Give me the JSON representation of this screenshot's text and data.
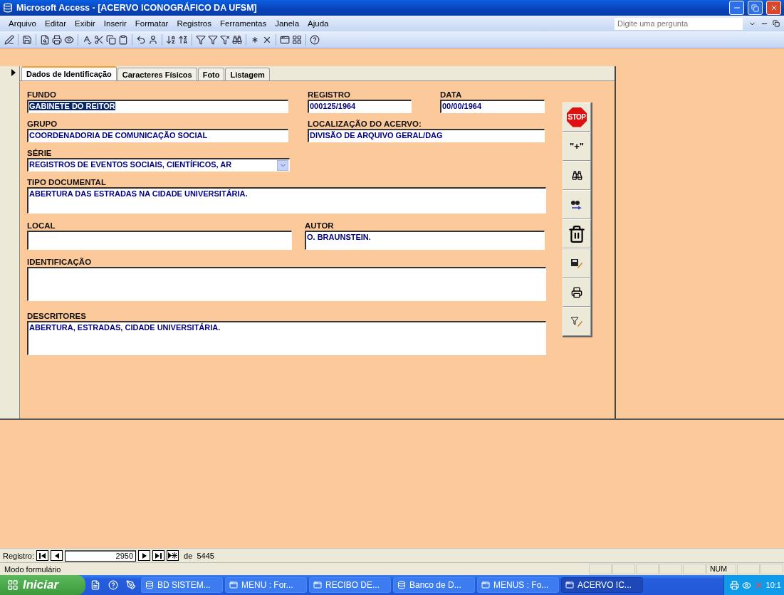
{
  "window": {
    "title": "Microsoft Access - [ACERVO ICONOGRÁFICO DA UFSM]"
  },
  "menu": [
    "Arquivo",
    "Editar",
    "Exibir",
    "Inserir",
    "Formatar",
    "Registros",
    "Ferramentas",
    "Janela",
    "Ajuda"
  ],
  "help_box": {
    "placeholder": "Digite uma pergunta"
  },
  "tabs": [
    {
      "label": "Dados de Identificação",
      "selected": true
    },
    {
      "label": "Caracteres Físicos",
      "selected": false
    },
    {
      "label": "Foto",
      "selected": false
    },
    {
      "label": "Listagem",
      "selected": false
    }
  ],
  "form_rows": [
    [
      {
        "label": "FUNDO",
        "value": "GABINETE DO REITOR",
        "kind": "text",
        "text_selected": true
      },
      {
        "label": "REGISTRO",
        "value": "000125/1964",
        "kind": "text",
        "text_selected": false
      },
      {
        "label": "DATA",
        "value": "00/00/1964",
        "kind": "text",
        "text_selected": false
      }
    ],
    [
      {
        "label": "GRUPO",
        "value": "COORDENADORIA DE COMUNICAÇÃO SOCIAL",
        "kind": "text",
        "text_selected": false
      },
      {
        "label": "LOCALIZAÇÃO DO ACERVO:",
        "value": "DIVISÃO DE ARQUIVO GERAL/DAG",
        "kind": "text",
        "text_selected": false
      }
    ],
    [
      {
        "label": "SÉRIE",
        "value": "REGISTROS DE EVENTOS SOCIAIS, CIENTÍFICOS, AR",
        "kind": "combo",
        "text_selected": false
      }
    ],
    [
      {
        "label": "TIPO DOCUMENTAL",
        "value": "ABERTURA DAS ESTRADAS NA CIDADE UNIVERSITÁRIA.",
        "kind": "memo",
        "text_selected": false
      }
    ],
    [
      {
        "label": "LOCAL",
        "kind": "tall"
      },
      {
        "label": "AUTOR",
        "value": "O. BRAUNSTEIN.",
        "kind": "tall",
        "text_selected": false
      }
    ],
    [
      {
        "label": "IDENTIFICAÇÃO",
        "kind": "memo2"
      }
    ],
    [
      {
        "label": "DESCRITORES",
        "value": "ABERTURA, ESTRADAS, CIDADE UNIVERSITÁRIA.",
        "kind": "memo2",
        "text_selected": false
      }
    ]
  ],
  "side_buttons": [
    {
      "kind": "stop",
      "label": "STOP"
    },
    {
      "kind": "new",
      "label": "\"+\""
    },
    {
      "kind": "find"
    },
    {
      "kind": "find_next"
    },
    {
      "kind": "delete"
    },
    {
      "kind": "save"
    },
    {
      "kind": "print"
    },
    {
      "kind": "filter"
    }
  ],
  "navigator": {
    "label": "Registro:",
    "current": "2950",
    "of_label": "de",
    "total": "5445"
  },
  "status_bar": {
    "text": "Modo formulário",
    "indicator": "NUM"
  },
  "taskbar": {
    "start": "Iniciar",
    "items": [
      {
        "label": "BD SISTEM...",
        "selected": false,
        "kind": "db"
      },
      {
        "label": "MENU : For...",
        "selected": false,
        "kind": "form"
      },
      {
        "label": "RECIBO DE...",
        "selected": false,
        "kind": "form"
      },
      {
        "label": "Banco de D...",
        "selected": false,
        "kind": "db"
      },
      {
        "label": "MENUS : Fo...",
        "selected": false,
        "kind": "form"
      },
      {
        "label": "ACERVO IC...",
        "selected": true,
        "kind": "form"
      }
    ],
    "clock": "10:1"
  }
}
